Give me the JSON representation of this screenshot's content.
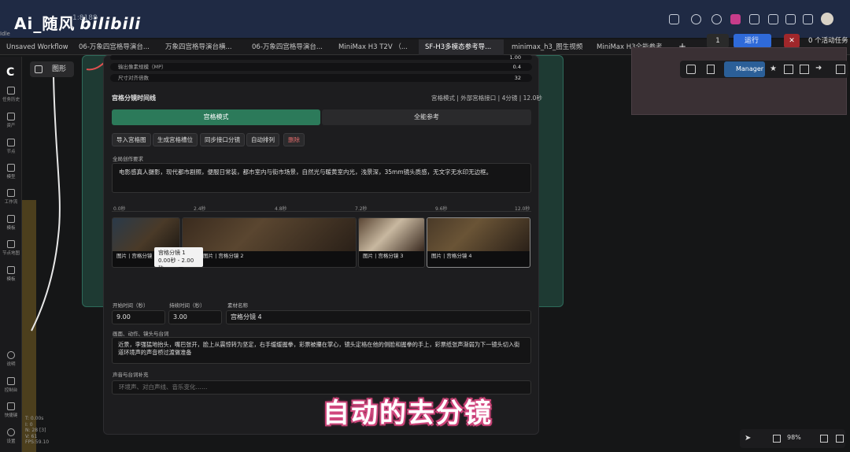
{
  "overlay": {
    "watermark": "Ai_随风",
    "watermark_brand": "bilibili",
    "caption": "自动的去分镜"
  },
  "browser": {
    "url": "1:8188",
    "colors": {
      "bar": "#1f2a44"
    }
  },
  "status": {
    "idle": "Idle"
  },
  "tabs": [
    {
      "label": "Unsaved Workflow"
    },
    {
      "label": "06-万象四宫格导演台..."
    },
    {
      "label": "万象四宫格导演台横..."
    },
    {
      "label": "06-万象四宫格导演台..."
    },
    {
      "label": "MiniMax H3 T2V （..."
    },
    {
      "label": "SF-H3多模态参考导...",
      "active": true
    },
    {
      "label": "minimax_h3_图生视频"
    },
    {
      "label": "MiniMax H3全能参考..."
    }
  ],
  "queue": {
    "count": "1",
    "run_label": "运行",
    "stop_label": "✕",
    "status": "0 个活动任务"
  },
  "node_selector": {
    "label": "图形"
  },
  "sidebar": {
    "items": [
      {
        "label": "任务历史"
      },
      {
        "label": "资产"
      },
      {
        "label": "节点"
      },
      {
        "label": "模型"
      },
      {
        "label": "工作流"
      },
      {
        "label": "模板"
      },
      {
        "label": "节点地图"
      },
      {
        "label": "模板"
      },
      {
        "label": "说明"
      },
      {
        "label": "控制台"
      },
      {
        "label": "快捷键"
      },
      {
        "label": "设置"
      }
    ]
  },
  "stats": {
    "lines": [
      "T: 0.00s",
      "I: 0",
      "N: 28 [3]",
      "V: 61",
      "FPS:59.10"
    ]
  },
  "toolbar": {
    "manager_label": "Manager"
  },
  "node": {
    "params": [
      {
        "label": "输出像素规模（MP）",
        "value": "0.4"
      },
      {
        "label": "尺寸对齐倍数",
        "value": "32"
      }
    ],
    "partial_value": "1.00",
    "section_title": "宫格分镜时间线",
    "section_info": "宫格模式 | 外部宫格接口 | 4分镜 | 12.0秒",
    "modes": {
      "grid": "宫格模式",
      "ref": "全能参考"
    },
    "actions": [
      "导入宫格图",
      "生成宫格槽位",
      "同步接口分镜",
      "自动排列",
      "删除"
    ],
    "prompt_label": "全局创作要求",
    "prompt_text": "电影感真人摄影，现代都市剧照，便服日常装，都市室内与街市场景，自然光与暖黄室内光，浅景深，35mm镜头质感，无文字无水印无边框。",
    "ticks": [
      "0.0秒",
      "2.4秒",
      "4.8秒",
      "7.2秒",
      "9.6秒",
      "12.0秒"
    ],
    "clips": [
      {
        "caption": "图片 | 宫格分镜 1"
      },
      {
        "caption": "图片 | 宫格分镜 2"
      },
      {
        "caption": "图片 | 宫格分镜 3"
      },
      {
        "caption": "图片 | 宫格分镜 4"
      }
    ],
    "tooltip": {
      "title": "宫格分镜 1",
      "range": "0.00秒 - 2.00秒"
    },
    "fields": {
      "start_label": "开始时间（秒）",
      "start_value": "9.00",
      "duration_label": "持续时间（秒）",
      "duration_value": "3.00",
      "name_label": "素材名称",
      "name_value": "宫格分镜 4"
    },
    "action_label": "画面、动作、镜头与台词",
    "action_text": "近景，李强猛地抬头，嘴巴张开，脸上从震惊转为坚定，右手缓缓握拳，彩票被攥在掌心，镜头定格在他的侧脸和握拳的手上，彩票纸张声渐弱为下一镜头切入街道环境声的声音桥过渡做准备",
    "sound_label": "声音与台词补充",
    "sound_placeholder": "环境声、对白声线、音乐变化……"
  },
  "bottom": {
    "zoom": "98%"
  }
}
